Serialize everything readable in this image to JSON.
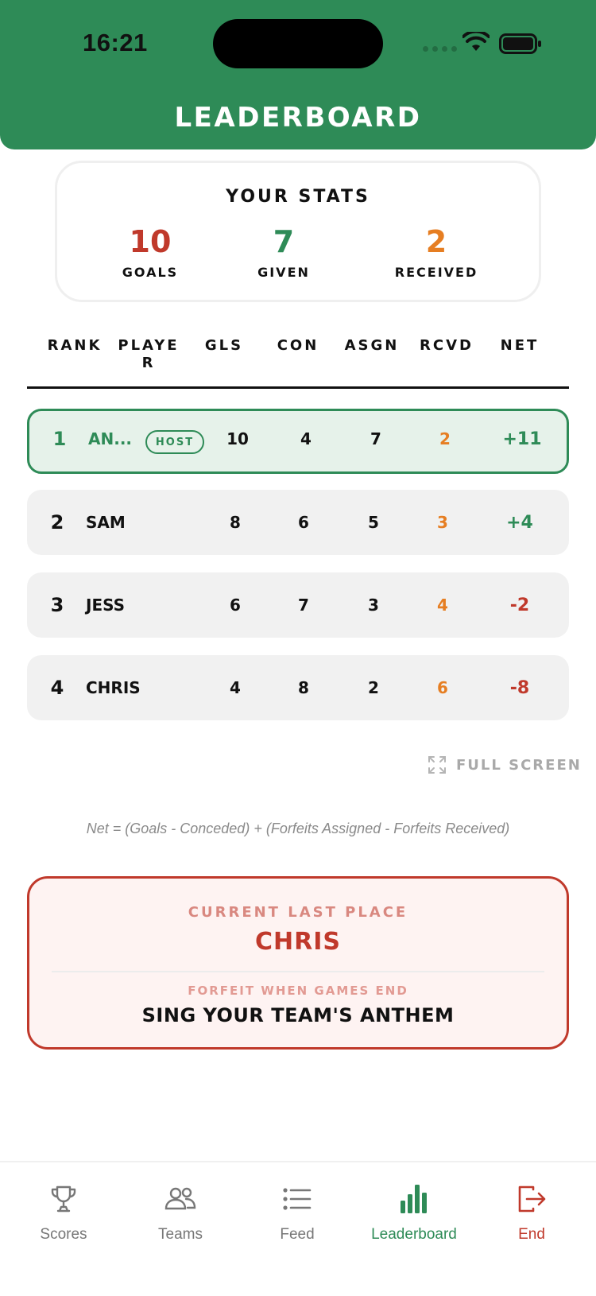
{
  "status_bar": {
    "time": "16:21"
  },
  "header": {
    "title": "LEADERBOARD",
    "color": "#2e8b57"
  },
  "your_stats": {
    "title": "YOUR STATS",
    "goals": {
      "value": "10",
      "label": "GOALS"
    },
    "given": {
      "value": "7",
      "label": "GIVEN"
    },
    "received": {
      "value": "2",
      "label": "RECEIVED"
    }
  },
  "table": {
    "headers": [
      "RANK",
      "PLAYER",
      "GLS",
      "CON",
      "ASGN",
      "RCVD",
      "NET"
    ],
    "rows": [
      {
        "rank": "1",
        "name": "AN...",
        "badge": "HOST",
        "gls": "10",
        "con": "4",
        "asgn": "7",
        "rcvd": "2",
        "net": "+11"
      },
      {
        "rank": "2",
        "name": "SAM",
        "gls": "8",
        "con": "6",
        "asgn": "5",
        "rcvd": "3",
        "net": "+4"
      },
      {
        "rank": "3",
        "name": "JESS",
        "gls": "6",
        "con": "7",
        "asgn": "3",
        "rcvd": "4",
        "net": "-2"
      },
      {
        "rank": "4",
        "name": "CHRIS",
        "gls": "4",
        "con": "8",
        "asgn": "2",
        "rcvd": "6",
        "net": "-8"
      }
    ]
  },
  "fullscreen": {
    "label": "FULL SCREEN"
  },
  "formula": "Net = (Goals - Conceded) + (Forfeits Assigned - Forfeits Received)",
  "last_place": {
    "label": "CURRENT LAST PLACE",
    "name": "CHRIS",
    "forfeit_label": "FORFEIT WHEN GAMES END",
    "forfeit": "SING YOUR TEAM'S ANTHEM"
  },
  "tabs": [
    {
      "label": "Scores",
      "icon": "trophy-icon"
    },
    {
      "label": "Teams",
      "icon": "users-icon"
    },
    {
      "label": "Feed",
      "icon": "list-icon"
    },
    {
      "label": "Leaderboard",
      "icon": "bar-chart-icon",
      "active": true
    },
    {
      "label": "End",
      "icon": "exit-icon"
    }
  ],
  "colors": {
    "accent": "#2e8b57",
    "danger": "#c0392b",
    "warning": "#e67e22"
  }
}
